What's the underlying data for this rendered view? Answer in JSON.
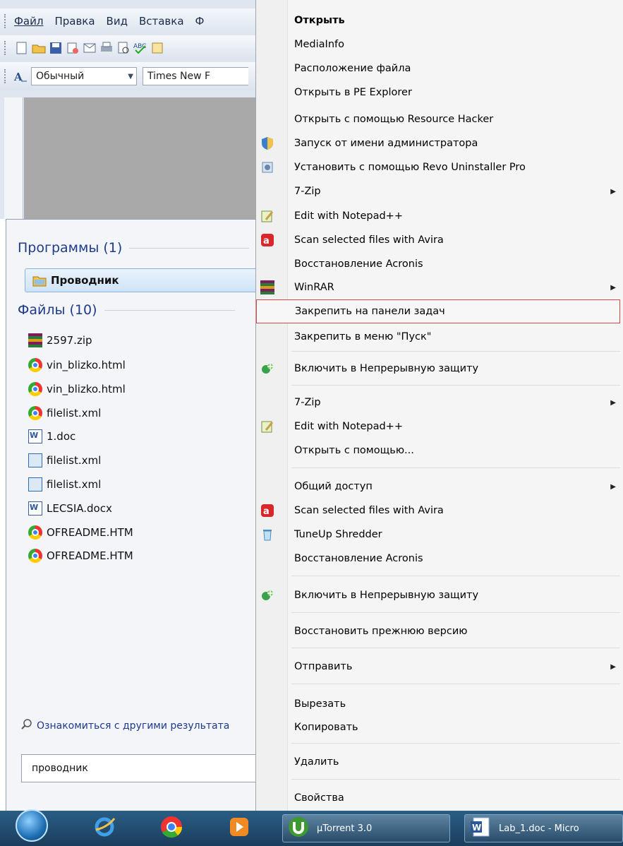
{
  "word": {
    "menu": [
      "Файл",
      "Правка",
      "Вид",
      "Вставка",
      "Ф"
    ],
    "style_combo": "Обычный",
    "font_combo": "Times New F"
  },
  "start_menu": {
    "programs_header": "Программы (1)",
    "program_item": "Проводник",
    "files_header": "Файлы (10)",
    "files": [
      {
        "name": "2597.zip",
        "icon": "winrar-icon"
      },
      {
        "name": "vin_blizko.html",
        "icon": "chrome-icon"
      },
      {
        "name": "vin_blizko.html",
        "icon": "chrome-icon"
      },
      {
        "name": "filelist.xml",
        "icon": "chrome-icon"
      },
      {
        "name": "1.doc",
        "icon": "word-doc-icon"
      },
      {
        "name": "filelist.xml",
        "icon": "xml-icon"
      },
      {
        "name": "filelist.xml",
        "icon": "xml-icon"
      },
      {
        "name": "LECSIA.docx",
        "icon": "word-doc-icon"
      },
      {
        "name": "OFREADME.HTM",
        "icon": "chrome-icon"
      },
      {
        "name": "OFREADME.HTM",
        "icon": "chrome-icon"
      }
    ],
    "more_results": "Ознакомиться с другими результата",
    "search_value": "проводник"
  },
  "context_menu": {
    "items": [
      {
        "label": "Открыть",
        "bold": true
      },
      {
        "label": "MediaInfo"
      },
      {
        "label": "Расположение файла"
      },
      {
        "label": "Открыть в PE Explorer"
      },
      {
        "label": "Открыть с помощью Resource Hacker"
      },
      {
        "label": "Запуск от имени администратора",
        "icon": "shield-icon"
      },
      {
        "label": "Установить с помощью Revo Uninstaller Pro",
        "icon": "revo-icon"
      },
      {
        "label": "7-Zip",
        "submenu": true
      },
      {
        "label": "Edit with Notepad++",
        "icon": "notepad-icon"
      },
      {
        "label": "Scan selected files with Avira",
        "icon": "avira-icon"
      },
      {
        "label": "Восстановление Acronis"
      },
      {
        "label": "WinRAR",
        "icon": "winrar-icon",
        "submenu": true
      },
      {
        "label": "Закрепить на панели задач",
        "highlighted": true
      },
      {
        "label": "Закрепить в меню \"Пуск\""
      },
      {
        "label": "Включить в Непрерывную защиту",
        "icon": "acronis-icon"
      },
      {
        "label": "7-Zip",
        "submenu": true
      },
      {
        "label": "Edit with Notepad++",
        "icon": "notepad-icon"
      },
      {
        "label": "Открыть с помощью..."
      },
      {
        "label": "Общий доступ",
        "submenu": true
      },
      {
        "label": "Scan selected files with Avira",
        "icon": "avira-icon"
      },
      {
        "label": "TuneUp Shredder",
        "icon": "shredder-icon"
      },
      {
        "label": "Восстановление Acronis"
      },
      {
        "label": "Включить в Непрерывную защиту",
        "icon": "acronis-icon"
      },
      {
        "label": "Восстановить прежнюю версию"
      },
      {
        "label": "Отправить",
        "submenu": true
      },
      {
        "label": "Вырезать"
      },
      {
        "label": "Копировать"
      },
      {
        "label": "Удалить"
      },
      {
        "label": "Свойства"
      }
    ]
  },
  "taskbar": {
    "tasks": [
      {
        "label": "µTorrent 3.0",
        "icon": "utorrent-icon"
      },
      {
        "label": "Lab_1.doc - Micro",
        "icon": "word-icon"
      }
    ]
  },
  "colors": {
    "highlight_border": "#e04646",
    "section_title": "#1e3a8a",
    "taskbar": "#1f4a6e"
  }
}
